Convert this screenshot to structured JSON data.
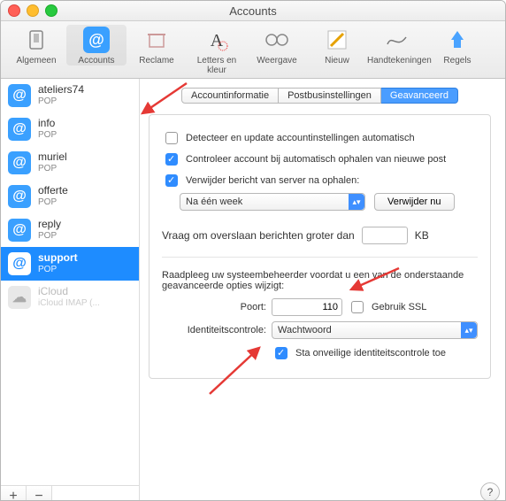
{
  "window_title": "Accounts",
  "toolbar": [
    {
      "label": "Algemeen",
      "icon": "general-icon"
    },
    {
      "label": "Accounts",
      "icon": "at-icon"
    },
    {
      "label": "Reclame",
      "icon": "junk-icon"
    },
    {
      "label": "Letters en kleur",
      "icon": "fonts-icon"
    },
    {
      "label": "Weergave",
      "icon": "viewing-icon"
    },
    {
      "label": "Nieuw",
      "icon": "compose-icon"
    },
    {
      "label": "Handtekeningen",
      "icon": "signature-icon"
    },
    {
      "label": "Regels",
      "icon": "rules-icon"
    }
  ],
  "toolbar_active_index": 1,
  "accounts": [
    {
      "name": "ateliers74",
      "proto": "POP"
    },
    {
      "name": "info",
      "proto": "POP"
    },
    {
      "name": "muriel",
      "proto": "POP"
    },
    {
      "name": "offerte",
      "proto": "POP"
    },
    {
      "name": "reply",
      "proto": "POP"
    },
    {
      "name": "support",
      "proto": "POP"
    },
    {
      "name": "iCloud",
      "proto": "iCloud IMAP (...",
      "kind": "cloud"
    }
  ],
  "accounts_selected_index": 5,
  "footer": {
    "add": "+",
    "remove": "−"
  },
  "tabs": {
    "account_info": "Accountinformatie",
    "mailbox": "Postbusinstellingen",
    "advanced": "Geavanceerd"
  },
  "tabs_active": "advanced",
  "advanced": {
    "detect_label": "Detecteer en update accountinstellingen automatisch",
    "detect_checked": false,
    "check_label": "Controleer account bij automatisch ophalen van nieuwe post",
    "check_checked": true,
    "remove_label": "Verwijder bericht van server na ophalen:",
    "remove_checked": true,
    "remove_after": "Na één week",
    "remove_now": "Verwijder nu",
    "skip_label_prefix": "Vraag om overslaan berichten groter dan",
    "skip_value": "",
    "skip_unit": "KB",
    "warning": "Raadpleeg uw systeembeheerder voordat u een van de onderstaande geavanceerde opties wijzigt:",
    "port_label": "Poort:",
    "port_value": "110",
    "ssl_label": "Gebruik SSL",
    "ssl_checked": false,
    "auth_label": "Identiteitscontrole:",
    "auth_value": "Wachtwoord",
    "insecure_label": "Sta onveilige identiteitscontrole toe",
    "insecure_checked": true
  },
  "help": "?"
}
